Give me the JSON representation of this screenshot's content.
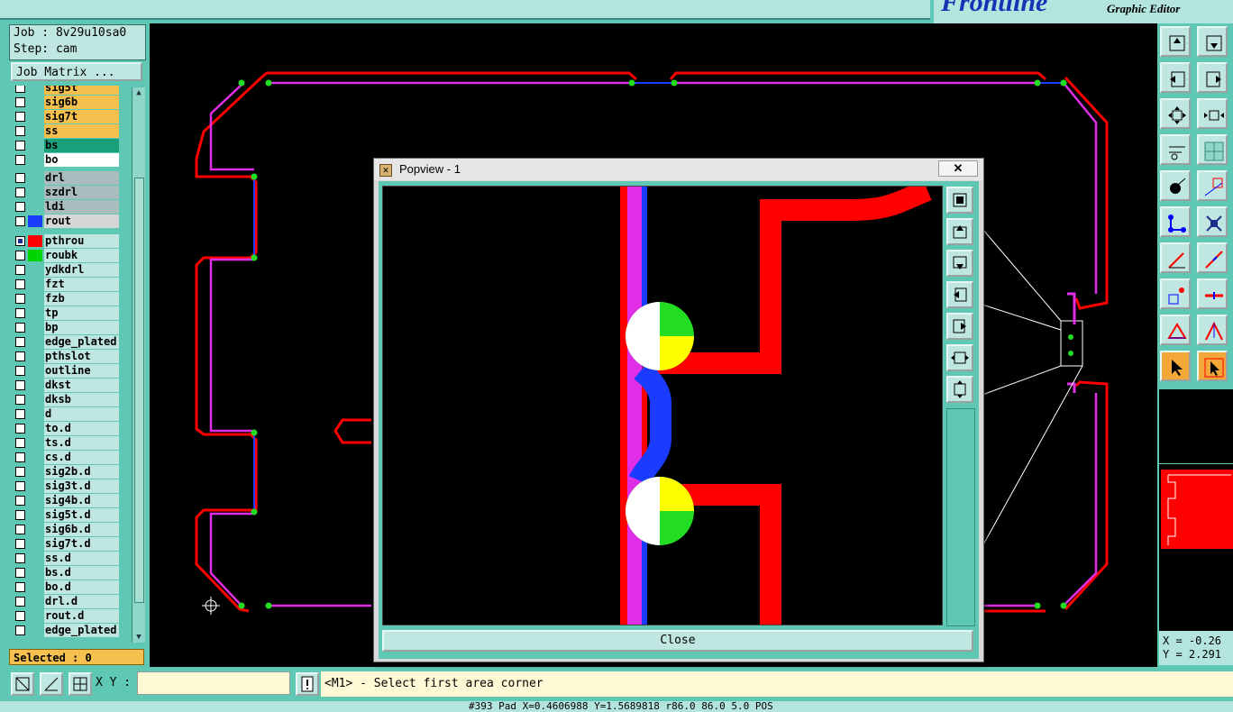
{
  "app": {
    "brand": "Frontline",
    "subtitle": "Graphic Editor"
  },
  "job": {
    "job_line": "Job : 8v29u10sa0",
    "step_line": "Step: cam",
    "matrix_button": "Job Matrix ..."
  },
  "layers": [
    {
      "name": "sig5t",
      "color": "#f5c04e",
      "swatch": "",
      "checked": false
    },
    {
      "name": "sig6b",
      "color": "#f5c04e",
      "swatch": "",
      "checked": false
    },
    {
      "name": "sig7t",
      "color": "#f5c04e",
      "swatch": "",
      "checked": false
    },
    {
      "name": "ss",
      "color": "#f5c04e",
      "swatch": "",
      "checked": false
    },
    {
      "name": "bs",
      "color": "#17a07a",
      "swatch": "",
      "checked": false
    },
    {
      "name": "bo",
      "color": "#ffffff",
      "swatch": "",
      "checked": false
    },
    {
      "name": "drl",
      "color": "#a9bdbe",
      "swatch": "",
      "checked": false
    },
    {
      "name": "szdrl",
      "color": "#a9bdbe",
      "swatch": "",
      "checked": false
    },
    {
      "name": "ldi",
      "color": "#a9bdbe",
      "swatch": "",
      "checked": false
    },
    {
      "name": "rout",
      "color": "#d6d6d6",
      "swatch": "#1b3cff",
      "checked": false
    },
    {
      "name": "pthrou",
      "color": "#bfe6e0",
      "swatch": "#ff0000",
      "checked": true,
      "marker": "⊞"
    },
    {
      "name": "roubk",
      "color": "#bfe6e0",
      "swatch": "#00d400",
      "checked": false
    },
    {
      "name": "ydkdrl",
      "color": "#bfe6e0",
      "swatch": "",
      "checked": false
    },
    {
      "name": "fzt",
      "color": "#bfe6e0",
      "swatch": "",
      "checked": false
    },
    {
      "name": "fzb",
      "color": "#bfe6e0",
      "swatch": "",
      "checked": false
    },
    {
      "name": "tp",
      "color": "#bfe6e0",
      "swatch": "",
      "checked": false
    },
    {
      "name": "bp",
      "color": "#bfe6e0",
      "swatch": "",
      "checked": false
    },
    {
      "name": "edge_plated",
      "color": "#bfe6e0",
      "swatch": "",
      "checked": false
    },
    {
      "name": "pthslot",
      "color": "#bfe6e0",
      "swatch": "",
      "checked": false
    },
    {
      "name": "outline",
      "color": "#bfe6e0",
      "swatch": "",
      "checked": false
    },
    {
      "name": "dkst",
      "color": "#bfe6e0",
      "swatch": "",
      "checked": false
    },
    {
      "name": "dksb",
      "color": "#bfe6e0",
      "swatch": "",
      "checked": false
    },
    {
      "name": "d",
      "color": "#bfe6e0",
      "swatch": "",
      "checked": false
    },
    {
      "name": "to.d",
      "color": "#bfe6e0",
      "swatch": "",
      "checked": false
    },
    {
      "name": "ts.d",
      "color": "#bfe6e0",
      "swatch": "",
      "checked": false
    },
    {
      "name": "cs.d",
      "color": "#bfe6e0",
      "swatch": "",
      "checked": false
    },
    {
      "name": "sig2b.d",
      "color": "#bfe6e0",
      "swatch": "",
      "checked": false
    },
    {
      "name": "sig3t.d",
      "color": "#bfe6e0",
      "swatch": "",
      "checked": false
    },
    {
      "name": "sig4b.d",
      "color": "#bfe6e0",
      "swatch": "",
      "checked": false
    },
    {
      "name": "sig5t.d",
      "color": "#bfe6e0",
      "swatch": "",
      "checked": false
    },
    {
      "name": "sig6b.d",
      "color": "#bfe6e0",
      "swatch": "",
      "checked": false
    },
    {
      "name": "sig7t.d",
      "color": "#bfe6e0",
      "swatch": "",
      "checked": false
    },
    {
      "name": "ss.d",
      "color": "#bfe6e0",
      "swatch": "",
      "checked": false
    },
    {
      "name": "bs.d",
      "color": "#bfe6e0",
      "swatch": "",
      "checked": false
    },
    {
      "name": "bo.d",
      "color": "#bfe6e0",
      "swatch": "",
      "checked": false
    },
    {
      "name": "drl.d",
      "color": "#bfe6e0",
      "swatch": "",
      "checked": false
    },
    {
      "name": "rout.d",
      "color": "#bfe6e0",
      "swatch": "",
      "checked": false
    },
    {
      "name": "edge_plated",
      "color": "#bfe6e0",
      "swatch": "",
      "checked": false
    }
  ],
  "selected": "Selected : 0",
  "popview": {
    "title": "Popview - 1",
    "close_label": "Close",
    "close_x": "✕"
  },
  "coords": {
    "x": "X = -0.26",
    "y": "Y = 2.291"
  },
  "bottom": {
    "xy_label": "X Y :",
    "xy_value": "",
    "message": "<M1> - Select first area corner",
    "status": "#393 Pad X=0.4606988 Y=1.5689818 r86.0 86.0 5.0 POS"
  },
  "icons": {
    "toolbar": [
      "zoom-fit-icon",
      "zoom-home-icon",
      "pan-left-icon",
      "pan-right-icon",
      "zoom-in-icon",
      "zoom-out-icon",
      "ruler-icon",
      "grid-icon",
      "snap-icon",
      "select-net-icon",
      "connect-icon",
      "delete-icon",
      "line-icon",
      "arc-icon",
      "pad-icon",
      "edge-icon",
      "measure-icon",
      "dimension-icon",
      "pointer-icon",
      "select-icon"
    ]
  }
}
